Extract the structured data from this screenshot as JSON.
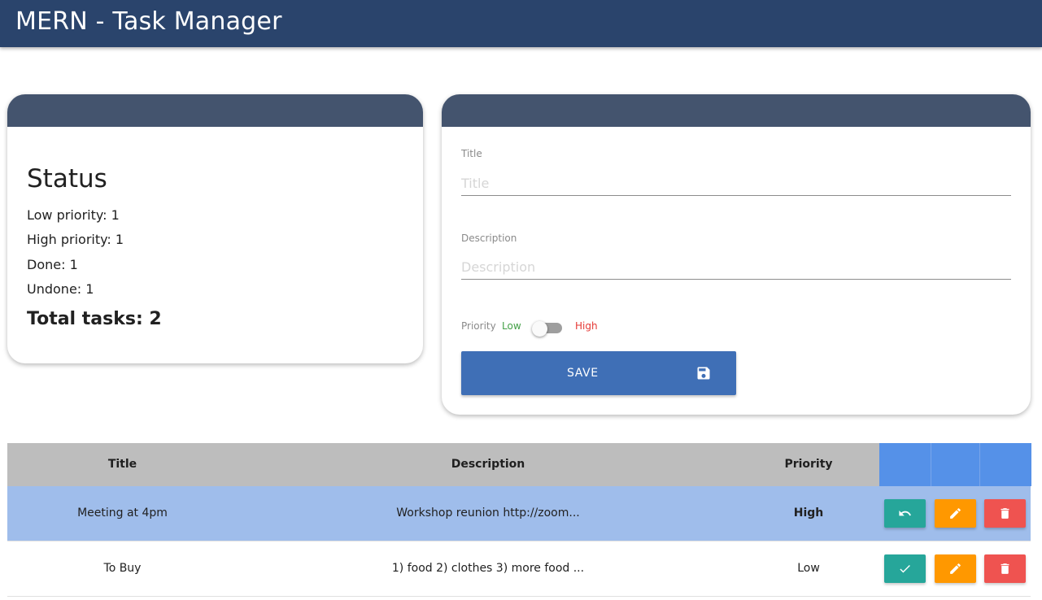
{
  "app": {
    "title": "MERN - Task Manager"
  },
  "status": {
    "title": "Status",
    "low_priority": "Low priority: 1",
    "high_priority": "High priority: 1",
    "done": "Done: 1",
    "undone": "Undone: 1",
    "total": "Total tasks: 2"
  },
  "form": {
    "title_label": "Title",
    "title_placeholder": "Title",
    "title_value": "",
    "description_label": "Description",
    "description_placeholder": "Description",
    "description_value": "",
    "priority_label": "Priority",
    "priority_low": "Low",
    "priority_high": "High",
    "priority_toggle_on": false,
    "save_label": "SAVE",
    "save_icon": "floppy-disk-icon"
  },
  "table": {
    "columns": [
      "Title",
      "Description",
      "Priority"
    ],
    "rows": [
      {
        "title": "Meeting at 4pm",
        "description": "Workshop reunion http://zoom...",
        "priority": "High",
        "done": true,
        "status_action_icon": "undo-icon"
      },
      {
        "title": "To Buy",
        "description": "1) food 2) clothes 3) more food ...",
        "priority": "Low",
        "done": false,
        "status_action_icon": "check-icon"
      }
    ]
  },
  "colors": {
    "appbar": "#2a446c",
    "card_header": "#44546e",
    "save_button": "#3f6fb6",
    "highlight_row": "#9fbdeb",
    "table_header": "#bdbdbd",
    "action_header": "#5591e8",
    "low": "#43a047",
    "high": "#e53935",
    "teal_button": "#26a69a",
    "orange_button": "#ff9800",
    "red_button": "#ef5350"
  }
}
